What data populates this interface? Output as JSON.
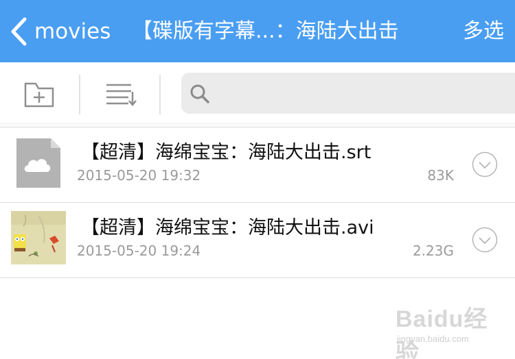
{
  "navbar": {
    "back_label": "movies",
    "title": "【碟版有字幕...：海陆大出击",
    "multi_select": "多选",
    "background": "#4a9ef2"
  },
  "toolbar": {
    "new_folder_icon": "folder-plus-icon",
    "sort_icon": "sort-list-icon",
    "search": {
      "icon": "search-icon",
      "value": "",
      "placeholder": ""
    }
  },
  "files": [
    {
      "name": "【超清】海绵宝宝：海陆大出击.srt",
      "date": "2015-05-20 19:32",
      "size": "83K",
      "icon": "cloud-file-icon"
    },
    {
      "name": "【超清】海绵宝宝：海陆大出击.avi",
      "date": "2015-05-20 19:24",
      "size": "2.23G",
      "icon": "video-thumbnail"
    }
  ],
  "watermark": {
    "brand": "Baidu经验",
    "url": "jingyan.baidu.com"
  }
}
